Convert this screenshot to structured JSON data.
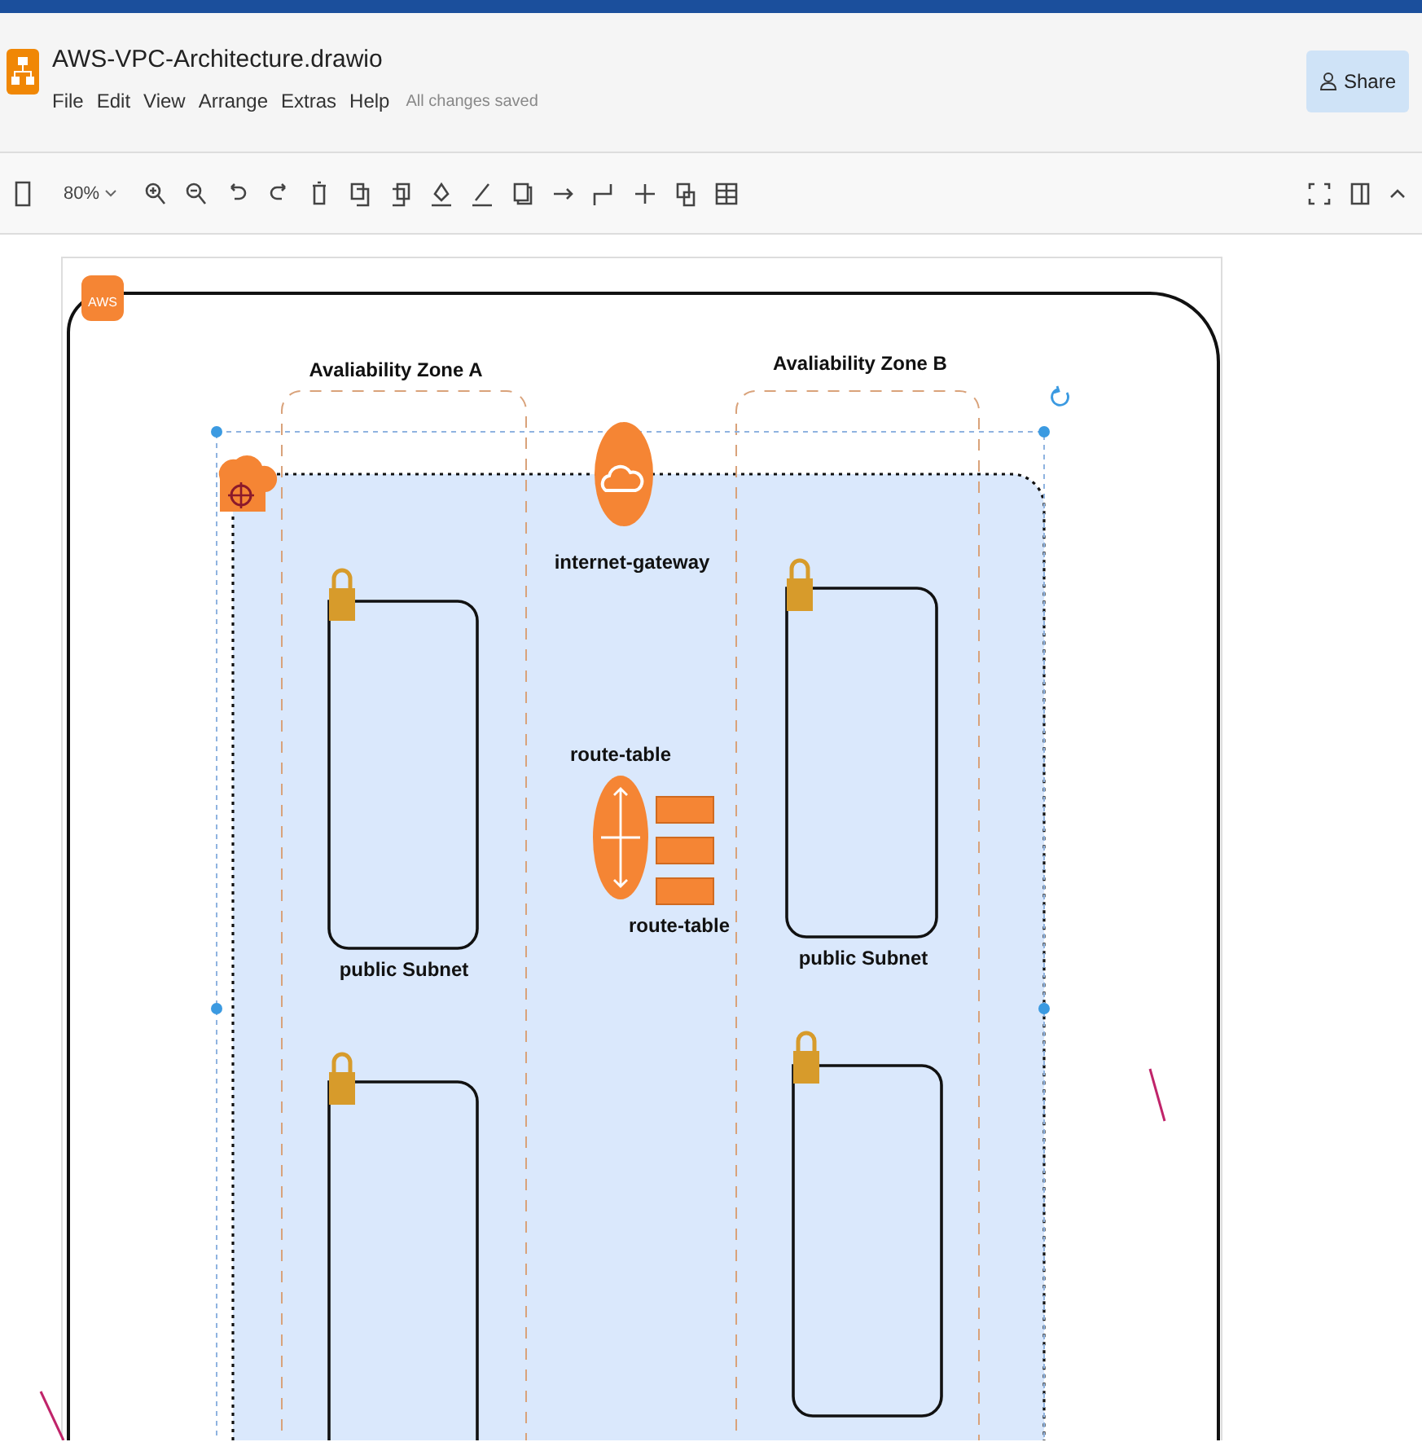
{
  "app": {
    "title": "AWS-VPC-Architecture.drawio",
    "menu": [
      "File",
      "Edit",
      "View",
      "Arrange",
      "Extras",
      "Help"
    ],
    "save_status": "All changes saved",
    "share_label": "Share"
  },
  "toolbar": {
    "zoom": "80%"
  },
  "diagram": {
    "cloud_badge": "AWS",
    "zones": [
      {
        "label": "Avaliability Zone A"
      },
      {
        "label": "Avaliability Zone B"
      }
    ],
    "gateway": {
      "label": "internet-gateway"
    },
    "route_table": {
      "top_label": "route-table",
      "bottom_label": "route-table"
    },
    "subnets": [
      {
        "label": "public Subnet"
      },
      {
        "label": "public Subnet"
      }
    ]
  }
}
